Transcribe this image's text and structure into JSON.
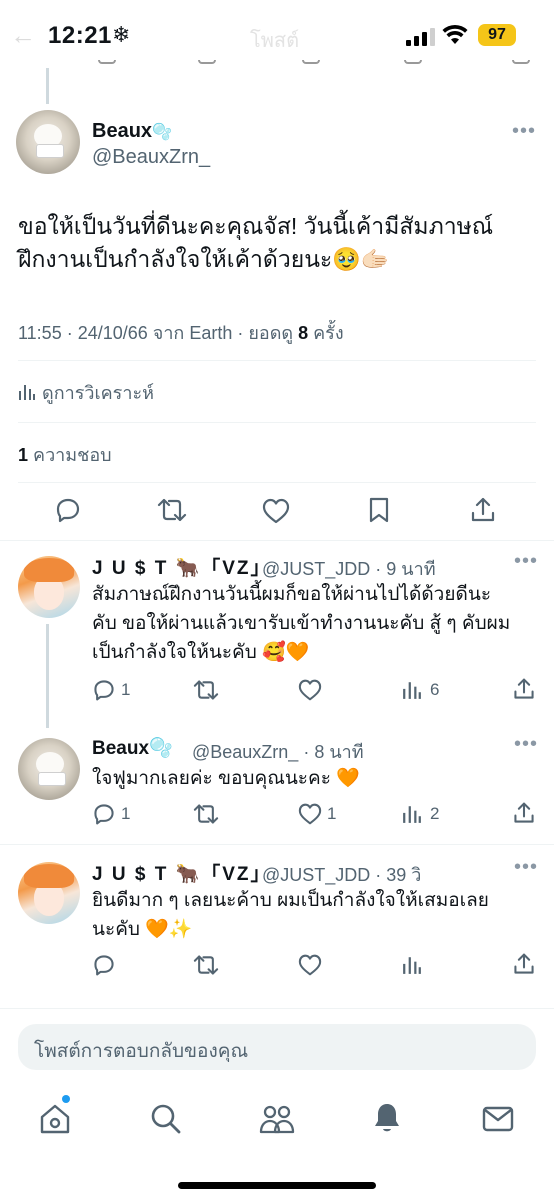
{
  "status_bar": {
    "time": "12:21",
    "weather_glyph": "❄",
    "battery": "97",
    "back_glyph": "←",
    "faded_title": "โพสต์"
  },
  "main_tweet": {
    "name": "Beaux",
    "name_badge": "🫧",
    "handle": "@BeauxZrn_",
    "more": "•••",
    "text_line1": "ขอให้เป็นวันที่ดีนะคะคุณจัส! วันนี้เค้ามีสัมภาษณ์",
    "text_line2": "ฝึกงานเป็นกำลังใจให้เค้าด้วยนะ🥹🫱🏻",
    "meta_prefix": "11:55 · 24/10/66 จาก Earth · ยอดดู ",
    "views": "8",
    "meta_suffix": " ครั้ง",
    "analytics_label": "ดูการวิเคราะห์",
    "likes_count": "1",
    "likes_label": "ความชอบ"
  },
  "replies": [
    {
      "name": "J U $ T 🐂「VZ」",
      "meta": "@JUST_JDD · 9 นาที",
      "lines": [
        "สัมภาษณ์ฝึกงานวันนี้ผมก็ขอให้ผ่านไปได้ด้วยดีนะ",
        "คับ ขอให้ผ่านแล้วเขารับเข้าทำงานนะคับ สู้ ๆ คับผม",
        "เป็นกำลังใจให้นะคับ 🥰🧡"
      ],
      "reply_count": "1",
      "retweet_count": "",
      "like_count": "",
      "view_count": "6"
    },
    {
      "name": "Beaux🫧",
      "meta": "@BeauxZrn_ · 8 นาที",
      "lines": [
        "ใจฟูมากเลยค่ะ ขอบคุณนะคะ 🧡"
      ],
      "reply_count": "1",
      "retweet_count": "",
      "like_count": "1",
      "view_count": "2"
    },
    {
      "name": "J U $ T 🐂「VZ」",
      "meta": "@JUST_JDD · 39 วิ",
      "lines": [
        "ยินดีมาก ๆ เลยนะค้าบ ผมเป็นกำลังใจให้เสมอเลย",
        "นะคับ 🧡✨"
      ],
      "reply_count": "",
      "retweet_count": "",
      "like_count": "",
      "view_count": ""
    }
  ],
  "compose": {
    "placeholder": "โพสต์การตอบกลับของคุณ"
  },
  "tabbar": [
    "home-icon",
    "search-icon",
    "communities-icon",
    "notifications-icon",
    "messages-icon"
  ]
}
